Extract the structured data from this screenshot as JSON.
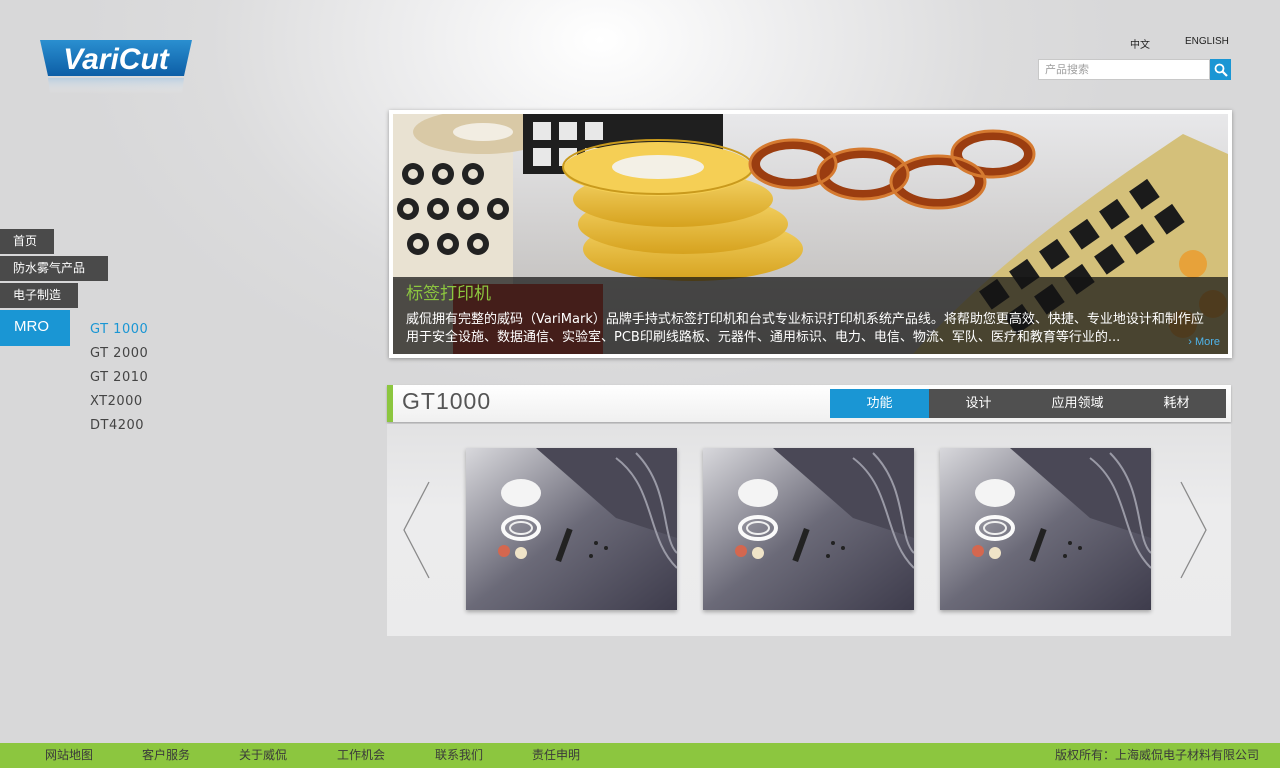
{
  "brand": {
    "logo_text": "VariCut",
    "accent": "#1a96d4",
    "green": "#8cc63f"
  },
  "header": {
    "lang_cn": "中文",
    "lang_en": "ENGLISH",
    "search": {
      "placeholder": "产品搜索",
      "icon": "search-icon"
    }
  },
  "nav": {
    "home": "首页",
    "fog": "防水雾气产品",
    "elec": "电子制造",
    "mro": "MRO",
    "sub_items": [
      "GT 1000",
      "GT 2000",
      "GT 2010",
      "XT2000",
      "DT4200"
    ]
  },
  "banner": {
    "title": "标签打印机",
    "text": "威侃拥有完整的威码（VariMark）品牌手持式标签打印机和台式专业标识打印机系统产品线。将帮助您更高效、快捷、专业地设计和制作应用于安全设施、数据通信、实验室、PCB印刷线路板、元器件、通用标识、电力、电信、物流、军队、医疗和教育等行业的...",
    "more": "› More"
  },
  "product": {
    "title": "GT1000",
    "tabs": [
      "功能",
      "设计",
      "应用领域",
      "耗材"
    ],
    "active_tab": "功能"
  },
  "footer": {
    "links": [
      "网站地图",
      "客户服务",
      "关于威侃",
      "工作机会",
      "联系我们",
      "责任申明"
    ],
    "copyright": "版权所有：上海威侃电子材料有限公司"
  }
}
